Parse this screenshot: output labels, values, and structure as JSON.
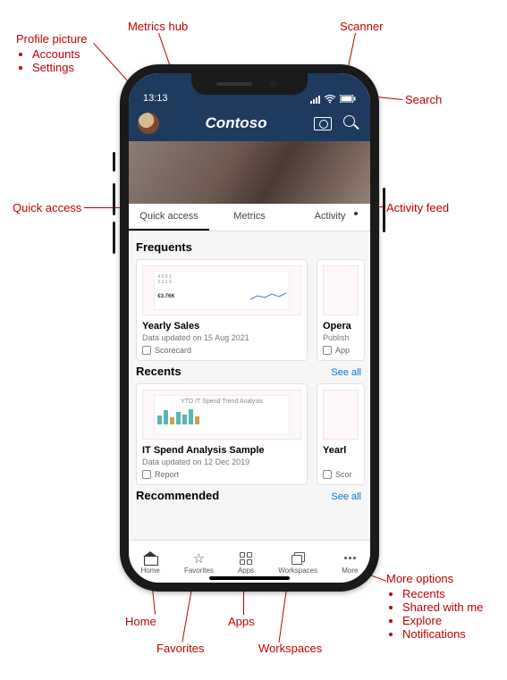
{
  "annotations": {
    "profile_title": "Profile picture",
    "profile_items": [
      "Accounts",
      "Settings"
    ],
    "metrics_hub": "Metrics hub",
    "scanner": "Scanner",
    "search": "Search",
    "quick_access": "Quick access",
    "activity_feed": "Activity feed",
    "home": "Home",
    "favorites": "Favorites",
    "apps": "Apps",
    "workspaces": "Workspaces",
    "more_title": "More options",
    "more_items": [
      "Recents",
      "Shared with me",
      "Explore",
      "Notifications"
    ]
  },
  "status": {
    "time": "13:13"
  },
  "brand": "Contoso",
  "tabs": {
    "quick": "Quick access",
    "metrics": "Metrics",
    "activity": "Activity"
  },
  "sections": {
    "frequents": {
      "title": "Frequents",
      "card1": {
        "title": "Yearly Sales",
        "sub": "Data updated on 15 Aug 2021",
        "type": "Scorecard"
      },
      "card2": {
        "title": "Opera",
        "sub": "Publish",
        "type": "App"
      }
    },
    "recents": {
      "title": "Recents",
      "seeall": "See all",
      "card1": {
        "title": "IT Spend Analysis Sample",
        "sub": "Data updated on 12 Dec 2019",
        "type": "Report",
        "thumb": "YTD IT Spend Trend Analysis"
      },
      "card2": {
        "title": "Yearl",
        "type": "Scor"
      }
    },
    "recommended": {
      "title": "Recommended",
      "seeall": "See all"
    }
  },
  "nav": {
    "home": "Home",
    "favorites": "Favorites",
    "apps": "Apps",
    "workspaces": "Workspaces",
    "more": "More"
  }
}
